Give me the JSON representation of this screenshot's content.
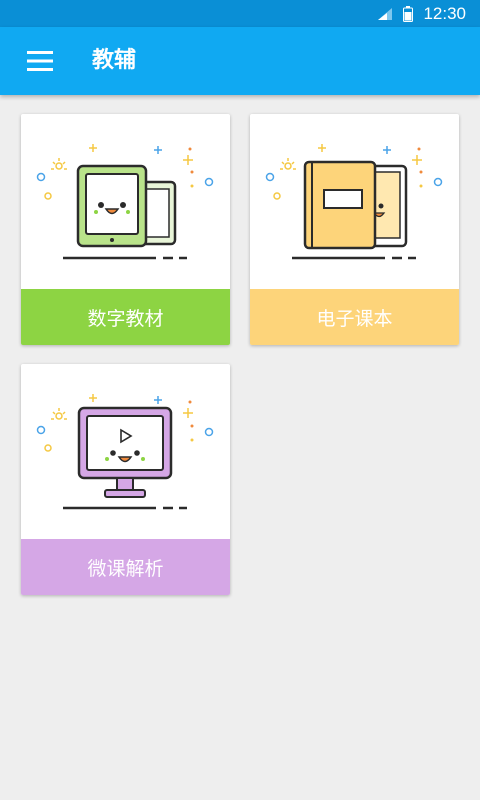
{
  "status_bar": {
    "time": "12:30",
    "icons": [
      "signal-icon",
      "battery-icon"
    ]
  },
  "app_bar": {
    "title": "教辅",
    "menu_icon": "menu-icon"
  },
  "cards": [
    {
      "label": "数字教材",
      "color": "#8dd443",
      "icon": "tablet-icon"
    },
    {
      "label": "电子课本",
      "color": "#fdd47a",
      "icon": "book-icon"
    },
    {
      "label": "微课解析",
      "color": "#d5a7e6",
      "icon": "monitor-play-icon"
    }
  ],
  "colors": {
    "status_bar": "#0a8fd6",
    "app_bar": "#10a9f2",
    "background": "#eeeeee"
  }
}
